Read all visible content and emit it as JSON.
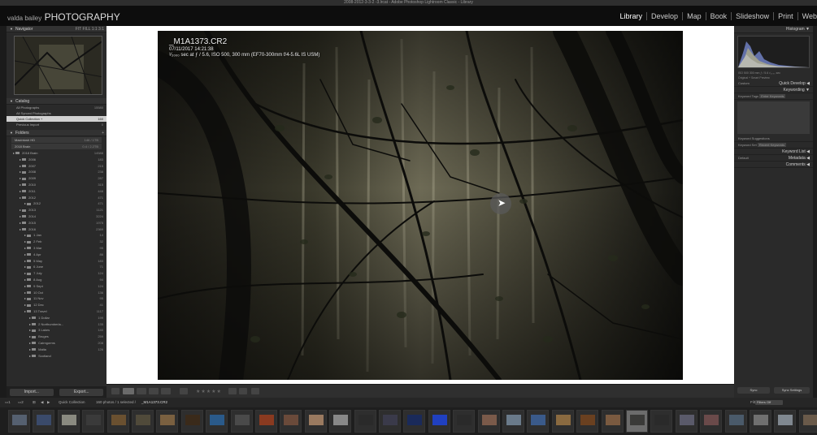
{
  "window": {
    "title": "2008-2012-3-3-2 -3.lrcat - Adobe Photoshop Lightroom Classic - Library"
  },
  "brand": {
    "owner": "valda bailey",
    "name": "PHOTOGRAPHY"
  },
  "modules": [
    "Library",
    "Develop",
    "Map",
    "Book",
    "Slideshow",
    "Print",
    "Web"
  ],
  "left_panel": {
    "navigator": {
      "title": "Navigator",
      "zoom": "FIT  FILL  1:1  3:1"
    },
    "catalog": {
      "title": "Catalog",
      "items": [
        {
          "label": "All Photographs",
          "count": "15580"
        },
        {
          "label": "All Synced Photographs",
          "count": ""
        },
        {
          "label": "Quick Collection +",
          "count": "160"
        },
        {
          "label": "Previous Import",
          "count": "0"
        }
      ]
    },
    "folders": {
      "title": "Folders",
      "volumes": [
        {
          "label": "Macintosh HD",
          "count": "146 / 1TB"
        },
        {
          "label": "2018 Brain",
          "count": "0.4 / 2.2TB"
        }
      ],
      "tree": [
        {
          "label": "2018 Brain",
          "count": "14588"
        },
        {
          "label": "2006",
          "count": "183"
        },
        {
          "label": "2007",
          "count": "215"
        },
        {
          "label": "2008",
          "count": "238"
        },
        {
          "label": "2009",
          "count": "287"
        },
        {
          "label": "2010",
          "count": "315"
        },
        {
          "label": "2011",
          "count": "448"
        },
        {
          "label": "2012",
          "count": "471"
        },
        {
          "label": "2012",
          "count": "471"
        },
        {
          "label": "2013",
          "count": "1121"
        },
        {
          "label": "2014",
          "count": "3224"
        },
        {
          "label": "2015",
          "count": "1975"
        },
        {
          "label": "2016",
          "count": "2369"
        },
        {
          "label": "1 Jan",
          "count": "14"
        },
        {
          "label": "2 Feb",
          "count": "32"
        },
        {
          "label": "3 Mar",
          "count": "95"
        },
        {
          "label": "4 Apr",
          "count": "86"
        },
        {
          "label": "5 May",
          "count": "183"
        },
        {
          "label": "6 June",
          "count": "71"
        },
        {
          "label": "7 July",
          "count": "124"
        },
        {
          "label": "8 Aug",
          "count": "94"
        },
        {
          "label": "9 Sept",
          "count": "124"
        },
        {
          "label": "10 Oct",
          "count": "136"
        },
        {
          "label": "11 Nov",
          "count": "95"
        },
        {
          "label": "12 Dec",
          "count": "41"
        },
        {
          "label": "13 Travel",
          "count": "1117"
        },
        {
          "label": "1 Dollar",
          "count": "199"
        },
        {
          "label": "2 Northumberla...",
          "count": "135"
        },
        {
          "label": "3 Lakes",
          "count": "140"
        },
        {
          "label": "Bruges",
          "count": "259"
        },
        {
          "label": "Cairngorms",
          "count": "208"
        },
        {
          "label": "Malta",
          "count": "126"
        },
        {
          "label": "Scotland",
          "count": ""
        }
      ]
    },
    "import_label": "Import...",
    "export_label": "Export..."
  },
  "photo": {
    "filename": "_M1A1373.CR2",
    "datetime": "07/11/2017 14:21:38",
    "exif": "¹⁄₂₀₀₀ sec at ƒ / 5.6, ISO 500, 300 mm (EF70-300mm f/4-5.6L IS USM)"
  },
  "toolbar": {
    "stars": "★★★★★"
  },
  "right_panel": {
    "histogram_title": "Histogram",
    "histogram_info": "ISO 500    300 mm    ƒ / 5.6    ¹⁄₂₀₀₀ sec",
    "original_label": "Original + Smart Preview",
    "quick_develop_title": "Quick Develop",
    "quick_develop_preset": "Custom",
    "keywording_title": "Keywording",
    "keyword_tags_label": "Keyword Tags",
    "keyword_tags_value": "Enter Keywords",
    "keyword_suggestions": "Keyword Suggestions",
    "keyword_set_label": "Keyword Set",
    "keyword_set_value": "Recent Keywords",
    "keyword_list_title": "Keyword List",
    "metadata_title": "Metadata",
    "metadata_preset": "Default",
    "comments_title": "Comments",
    "sync_label": "Sync",
    "sync_settings_label": "Sync Settings"
  },
  "filmstrip_bar": {
    "source": "Quick Collection",
    "status": "160 photos / 1 selected /",
    "selected_file": "_M1A1373.CR2",
    "filter_label": "Filter:",
    "filter_value": "Filters Off"
  },
  "colors": {
    "selected_row": "#d0d0d0",
    "panel_bg": "#2a2a2a",
    "canvas_bg": "#ffffff"
  }
}
